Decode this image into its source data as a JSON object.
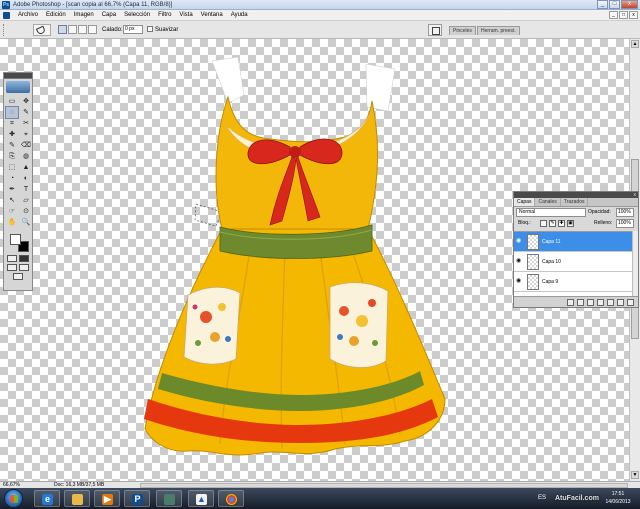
{
  "window": {
    "title": "Adobe Photoshop - [scan copia al 66,7% (Capa 11, RGB/8)]",
    "app_icon": "photoshop-icon",
    "buttons": [
      "_",
      "□",
      "x"
    ]
  },
  "menubar": {
    "items": [
      "Archivo",
      "Edición",
      "Imagen",
      "Capa",
      "Selección",
      "Filtro",
      "Vista",
      "Ventana",
      "Ayuda"
    ],
    "doc_buttons": [
      "_",
      "□",
      "x"
    ]
  },
  "options": {
    "tool_icon": "lasso-icon",
    "feather_label": "Calado:",
    "feather_value": "0 px",
    "antialias_label": "Suavizar",
    "well_tabs": [
      "Pinceles",
      "Herram. preest."
    ]
  },
  "toolbox": {
    "tools": [
      "▭",
      "✥",
      "◌",
      "✎",
      "⌗",
      "✂",
      "✚",
      "⌖",
      "✎",
      "⌫",
      "⎘",
      "◍",
      "⬚",
      "▲",
      "◔",
      "◐",
      "✒",
      "T",
      "↖",
      "▱",
      "☞",
      "⊙",
      "✋",
      "🔍"
    ],
    "foreground_color": "#ffffff",
    "background_color": "#000000"
  },
  "layers_panel": {
    "tabs": [
      "Capas",
      "Canales",
      "Trazados"
    ],
    "blend_mode": "Normal",
    "opacity_label": "Opacidad:",
    "opacity_value": "100%",
    "lock_label": "Bloq.:",
    "fill_label": "Relleno:",
    "fill_value": "100%",
    "layers": [
      {
        "name": "Capa 11",
        "selected": true
      },
      {
        "name": "Capa 10",
        "selected": false
      },
      {
        "name": "Capa 9",
        "selected": false
      }
    ]
  },
  "statusbar": {
    "zoom": "66,67%",
    "doc_size": "Doc: 16,3 MB/37,5 MB"
  },
  "taskbar": {
    "apps": [
      "internet-explorer",
      "file-explorer",
      "media-player",
      "photoshop",
      "network",
      "cloud-drive",
      "chrome"
    ],
    "language": "ES",
    "time": "17:51",
    "date": "14/06/2013"
  },
  "watermark": "AtuFacil.com",
  "colors": {
    "dress_yellow": "#f5b800",
    "bow_red": "#d8271c",
    "sash_green": "#6f8a2e",
    "stripe_red": "#e53a12",
    "selection_blue": "#3d8ee8"
  }
}
